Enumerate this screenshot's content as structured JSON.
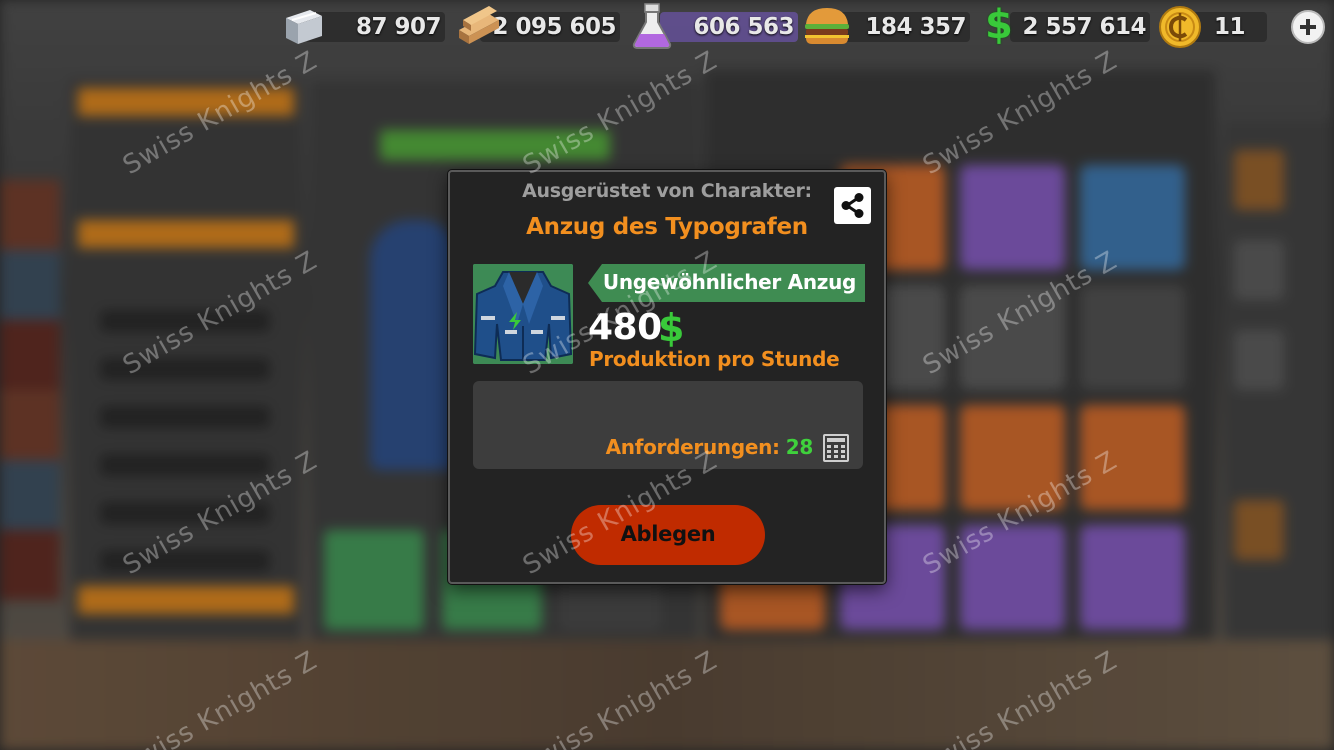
{
  "resources": [
    {
      "name": "iron",
      "icon": "iron-ingot-icon",
      "value": "87 907"
    },
    {
      "name": "wood",
      "icon": "wood-planks-icon",
      "value": "2 095 605"
    },
    {
      "name": "potion",
      "icon": "potion-flask-icon",
      "value": "606 563"
    },
    {
      "name": "food",
      "icon": "burger-icon",
      "value": "184 357"
    },
    {
      "name": "money",
      "icon": "dollar-icon",
      "value": "2 557 614"
    },
    {
      "name": "coins",
      "icon": "coin-icon",
      "value": "11"
    }
  ],
  "modal": {
    "equipped_label": "Ausgerüstet von Charakter:",
    "item_title": "Anzug des Typografen",
    "rarity": "Ungewöhnlicher Anzug",
    "production_value": "480",
    "production_label": "Produktion pro Stunde",
    "requirements_label": "Anforderungen:",
    "requirements_value": "28",
    "drop_button": "Ablegen"
  },
  "watermark": "Swiss Knights Z",
  "colors": {
    "accent_orange": "#f28f1f",
    "rarity_green": "#3f8c52",
    "money_green": "#39c93a",
    "drop_red": "#c02b00"
  }
}
